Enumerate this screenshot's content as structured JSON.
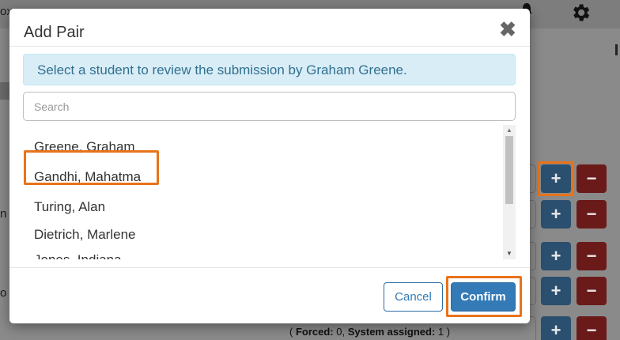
{
  "background": {
    "edge_texts": [
      "ox",
      "n",
      "o"
    ],
    "forced": {
      "open": "(",
      "forced_label": "Forced:",
      "forced_value": "0,",
      "system_label": "System assigned:",
      "system_value": "1",
      "close": ")"
    },
    "row_buttons": {
      "plus": "+",
      "minus": "−"
    },
    "icons": {
      "settings": "gear-icon",
      "notifications": "bell-icon"
    }
  },
  "modal": {
    "title": "Add Pair",
    "close_label": "✖",
    "alert_text": "Select a student to review the submission by Graham Greene.",
    "search": {
      "placeholder": "Search",
      "value": ""
    },
    "students": [
      "Greene, Graham",
      "Gandhi, Mahatma",
      "Turing, Alan",
      "Dietrich, Marlene",
      "Jones, Indiana"
    ],
    "highlighted_student": "Gandhi, Mahatma",
    "cancel_label": "Cancel",
    "confirm_label": "Confirm"
  },
  "colors": {
    "primary": "#337ab7",
    "alert_bg": "#d9edf7",
    "alert_text": "#31708f",
    "highlight": "#e8731a",
    "danger": "#6b1a1a"
  }
}
